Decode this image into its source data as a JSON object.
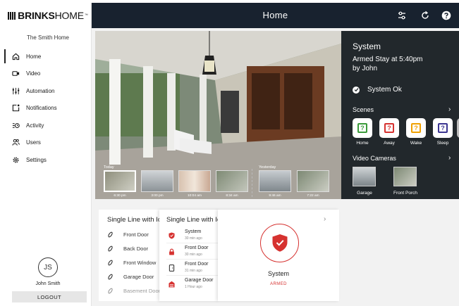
{
  "brand": {
    "strong": "BRINKS",
    "light": "HOME",
    "tm": "™"
  },
  "sidebar": {
    "account_name": "The Smith Home",
    "items": [
      {
        "label": "Home",
        "icon": "home-icon"
      },
      {
        "label": "Video",
        "icon": "video-camera-icon"
      },
      {
        "label": "Automation",
        "icon": "automation-icon"
      },
      {
        "label": "Notifications",
        "icon": "notifications-icon"
      },
      {
        "label": "Activity",
        "icon": "activity-icon"
      },
      {
        "label": "Users",
        "icon": "users-icon"
      },
      {
        "label": "Settings",
        "icon": "gear-icon"
      }
    ],
    "active_index": 0,
    "user_initials": "JS",
    "user_name": "John Smith",
    "logout_label": "LOGOUT"
  },
  "header": {
    "title": "Home",
    "icons": [
      "filter-sliders-icon",
      "refresh-icon",
      "help-icon"
    ],
    "background": "#18222f"
  },
  "hero": {
    "today_label": "Today",
    "yesterday_label": "Yesterday",
    "thumbnails": [
      {
        "time": "6:30 pm"
      },
      {
        "time": "3:00 pm"
      },
      {
        "time": "10:04 am"
      },
      {
        "time": "8:34 am"
      },
      {
        "time": "9:46 am"
      },
      {
        "time": "7:22 am"
      }
    ],
    "active_thumbnail": 0
  },
  "system_panel": {
    "title": "System",
    "status_line1": "Armed Stay at 5:40pm",
    "status_line2": "by John",
    "ok_text": "System Ok",
    "scenes_label": "Scenes",
    "scenes": [
      {
        "label": "Home",
        "color": "#3a9a3a"
      },
      {
        "label": "Away",
        "color": "#d63230"
      },
      {
        "label": "Wake",
        "color": "#f0a000"
      },
      {
        "label": "Sleep",
        "color": "#3b3591"
      }
    ],
    "cameras_label": "Video Cameras",
    "cameras": [
      {
        "label": "Garage"
      },
      {
        "label": "Front Porch"
      }
    ],
    "background": "#22282c"
  },
  "card_doors": {
    "title": "Single Line with Icon",
    "items": [
      "Front Door",
      "Back Door",
      "Front Window",
      "Garage Door",
      "Basement Door"
    ]
  },
  "card_events": {
    "title": "Single Line with Icon",
    "items": [
      {
        "title": "System",
        "time": "30 min ago",
        "icon": "shield-icon"
      },
      {
        "title": "Front Door",
        "time": "30 min ago",
        "icon": "lock-icon"
      },
      {
        "title": "Front Door",
        "time": "31 min ago",
        "icon": "door-sensor-icon"
      },
      {
        "title": "Garage Door",
        "time": "1 Hour ago",
        "icon": "garage-icon"
      }
    ]
  },
  "card_system": {
    "name": "System",
    "status": "ARMED",
    "accent": "#d63230"
  }
}
